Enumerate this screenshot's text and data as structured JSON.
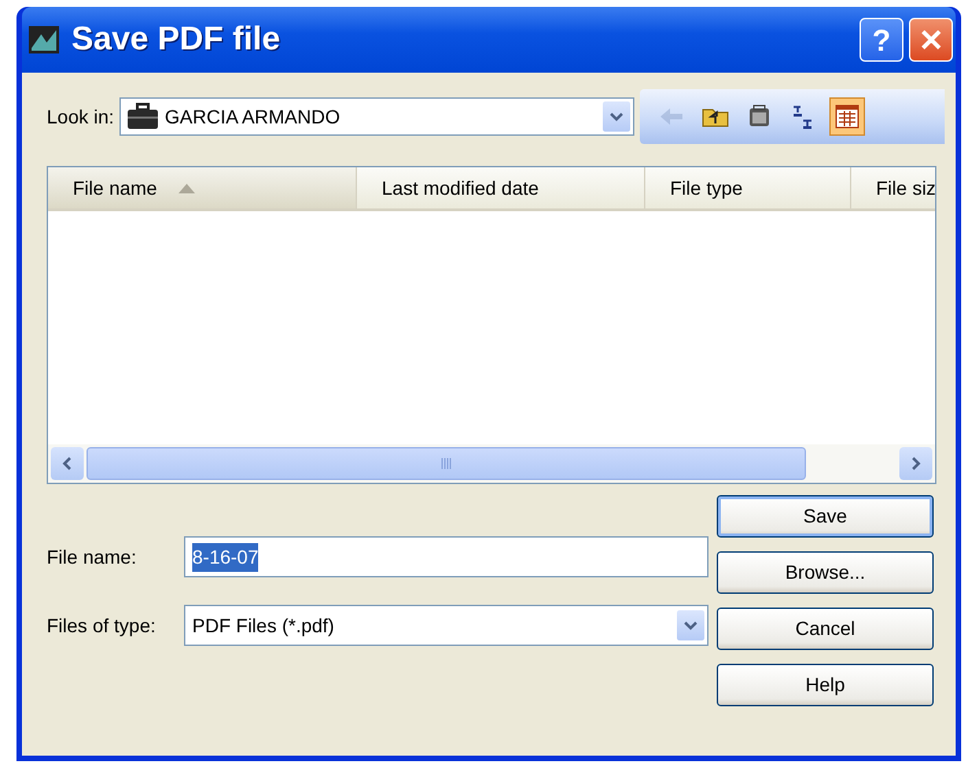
{
  "window": {
    "title": "Save PDF file"
  },
  "title_buttons": [
    {
      "kind": "help",
      "label": "?"
    },
    {
      "kind": "close",
      "label": "✕"
    }
  ],
  "look_in": {
    "label": "Look in:",
    "value": "GARCIA ARMANDO"
  },
  "toolbar": [
    {
      "kind": "back",
      "disabled": true,
      "selected": false
    },
    {
      "kind": "up",
      "disabled": false,
      "selected": false
    },
    {
      "kind": "new-folder",
      "disabled": false,
      "selected": false
    },
    {
      "kind": "list",
      "disabled": false,
      "selected": false
    },
    {
      "kind": "details",
      "disabled": false,
      "selected": true
    }
  ],
  "file_list": {
    "columns": [
      {
        "label": "File name",
        "sorted": true
      },
      {
        "label": "Last modified date",
        "sorted": false
      },
      {
        "label": "File type",
        "sorted": false
      },
      {
        "label": "File siz",
        "sorted": false
      }
    ]
  },
  "file_name": {
    "label": "File name:",
    "value": "8-16-07",
    "selected": true
  },
  "file_type": {
    "label": "Files of type:",
    "value": "PDF Files (*.pdf)"
  },
  "buttons": [
    {
      "label": "Save",
      "default": true
    },
    {
      "label": "Browse...",
      "default": false
    },
    {
      "label": "Cancel",
      "default": false
    },
    {
      "label": "Help",
      "default": false
    }
  ]
}
